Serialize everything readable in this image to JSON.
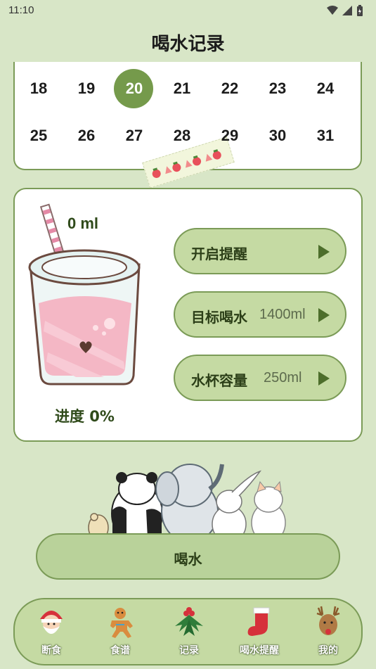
{
  "status_bar": {
    "time": "11:10"
  },
  "header": {
    "title": "喝水记录"
  },
  "calendar": {
    "rows": [
      [
        "18",
        "19",
        "20",
        "21",
        "22",
        "23",
        "24"
      ],
      [
        "25",
        "26",
        "27",
        "28",
        "29",
        "30",
        "31"
      ]
    ],
    "selected": "20"
  },
  "water": {
    "amount": "0 ml",
    "progress_label": "进度 0%",
    "progress_fraction": 0
  },
  "options": {
    "reminder": {
      "label": "开启提醒"
    },
    "goal": {
      "label": "目标喝水",
      "value": "1400ml"
    },
    "cup": {
      "label": "水杯容量",
      "value": "250ml"
    }
  },
  "drink_button": {
    "label": "喝水"
  },
  "nav": {
    "items": [
      {
        "label": "断食",
        "icon": "santa-icon"
      },
      {
        "label": "食谱",
        "icon": "gingerbread-icon"
      },
      {
        "label": "记录",
        "icon": "holly-icon"
      },
      {
        "label": "喝水提醒",
        "icon": "stocking-icon"
      },
      {
        "label": "我的",
        "icon": "reindeer-icon"
      }
    ]
  },
  "colors": {
    "background": "#d8e6c7",
    "accent": "#759a4b",
    "button": "#c5daa3",
    "border": "#7b9b57"
  }
}
